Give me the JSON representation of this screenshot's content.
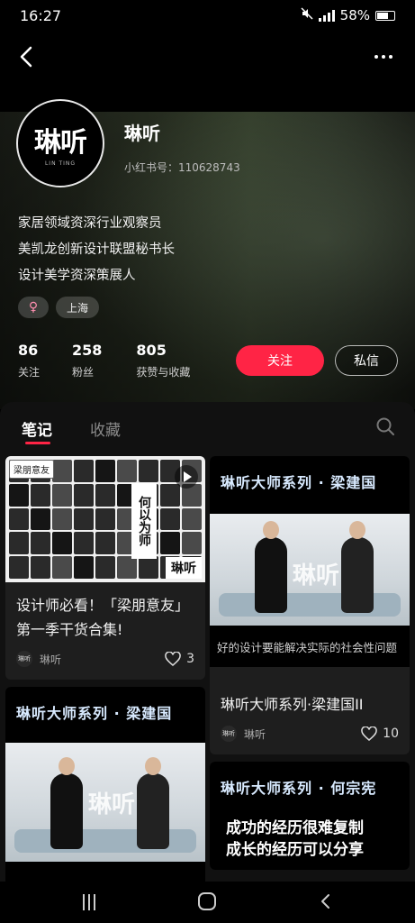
{
  "status_bar": {
    "time": "16:27",
    "battery": "58%"
  },
  "profile": {
    "name": "琳听",
    "avatar_logo": "琳听",
    "avatar_sub": "LIN TING",
    "id_text": "小红书号：110628743",
    "bio": [
      "家居领域资深行业观察员",
      "美凯龙创新设计联盟秘书长",
      "设计美学资深策展人"
    ],
    "gender_symbol": "♀",
    "location": "上海",
    "stats": [
      {
        "num": "86",
        "label": "关注"
      },
      {
        "num": "258",
        "label": "粉丝"
      },
      {
        "num": "805",
        "label": "获赞与收藏"
      }
    ],
    "follow_label": "关注",
    "message_label": "私信"
  },
  "tabs": {
    "notes": "笔记",
    "collections": "收藏"
  },
  "notes": {
    "left": [
      {
        "cover_badge": "梁朋意友",
        "cover_vertical": "何以为师",
        "cover_logo": "琳听",
        "title": "设计师必看！「梁朋意友」第一季干货合集!",
        "author": "琳听",
        "likes": "3"
      },
      {
        "cover_title": "琳听大师系列 · 梁建国"
      }
    ],
    "right": [
      {
        "cover_title": "琳听大师系列 · 梁建国",
        "caption": "好的设计要能解决实际的社会性问题",
        "title": "琳听大师系列·梁建国II",
        "author": "琳听",
        "likes": "10"
      },
      {
        "cover_title": "琳听大师系列 · 何宗宪",
        "cover_text_1": "成功的经历很难复制",
        "cover_text_2": "成长的经历可以分享"
      }
    ]
  },
  "scene_logo": "琳听",
  "colors": {
    "accent": "#ff2445",
    "panel": "#111111"
  }
}
